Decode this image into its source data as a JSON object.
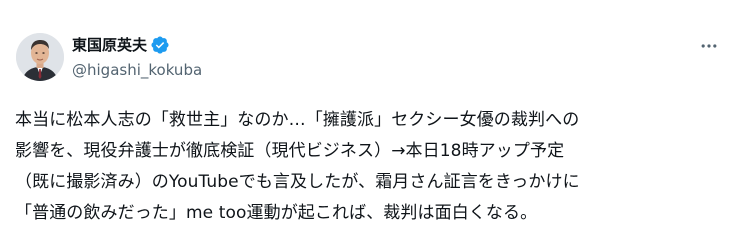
{
  "author": {
    "display_name": "東国原英夫",
    "handle": "@higashi_kokuba",
    "verified": true,
    "verified_color": "#1d9bf0",
    "avatar_icon": "person-portrait"
  },
  "actions": {
    "more_icon": "more-horizontal"
  },
  "post": {
    "lines": [
      "本当に松本人志の「救世主」なのか…「擁護派」セクシー女優の裁判への",
      "影響を、現役弁護士が徹底検証（現代ビジネス）→本日18時アップ予定",
      "（既に撮影済み）のYouTubeでも言及したが、霜月さん証言をきっかけに",
      "「普通の飲みだった」me too運動が起これば、裁判は面白くなる。"
    ]
  },
  "colors": {
    "text_primary": "#0f1419",
    "text_secondary": "#536471",
    "background": "#ffffff"
  }
}
